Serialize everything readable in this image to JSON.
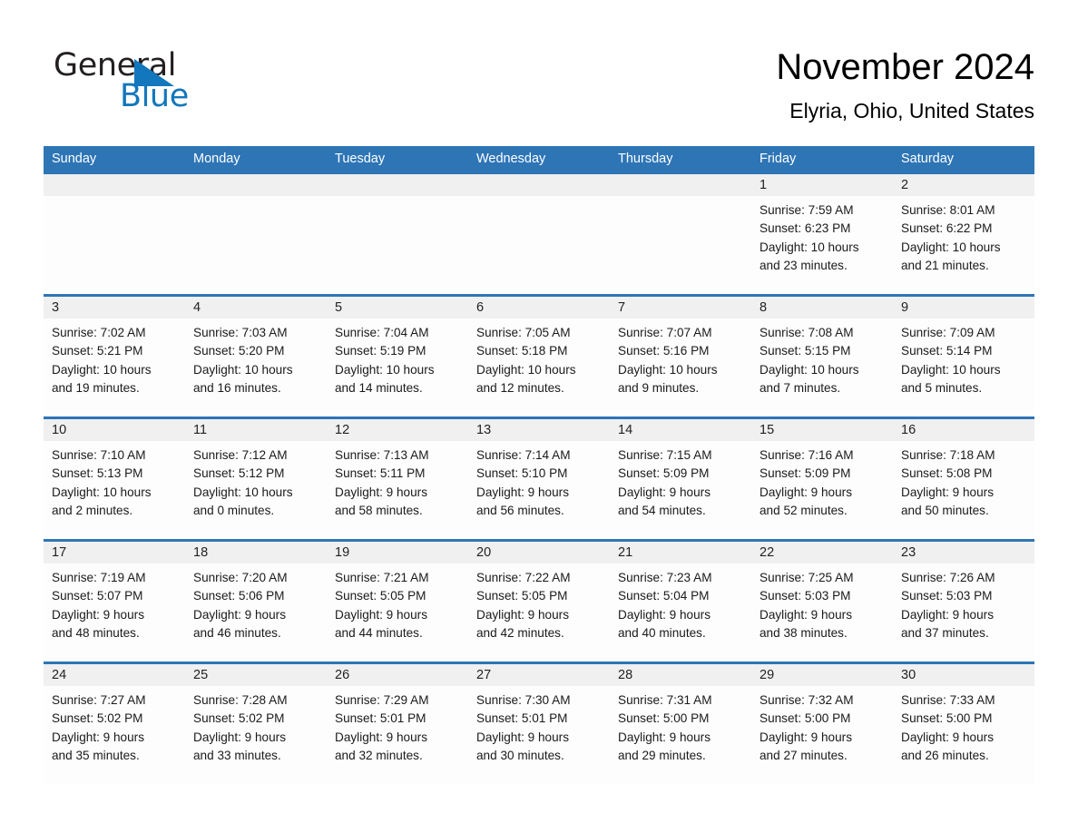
{
  "logo": {
    "word_one": "General",
    "word_two": "Blue",
    "triangle_color": "#1277bc"
  },
  "header": {
    "month_title": "November 2024",
    "location": "Elyria, Ohio, United States"
  },
  "colors": {
    "header_blue": "#2e75b6",
    "day_strip_gray": "#f0f0f0",
    "logo_blue": "#1277bc"
  },
  "weekdays": [
    "Sunday",
    "Monday",
    "Tuesday",
    "Wednesday",
    "Thursday",
    "Friday",
    "Saturday"
  ],
  "weeks": [
    [
      {
        "date": "",
        "sunrise": "",
        "sunset": "",
        "daylight_line1": "",
        "daylight_line2": ""
      },
      {
        "date": "",
        "sunrise": "",
        "sunset": "",
        "daylight_line1": "",
        "daylight_line2": ""
      },
      {
        "date": "",
        "sunrise": "",
        "sunset": "",
        "daylight_line1": "",
        "daylight_line2": ""
      },
      {
        "date": "",
        "sunrise": "",
        "sunset": "",
        "daylight_line1": "",
        "daylight_line2": ""
      },
      {
        "date": "",
        "sunrise": "",
        "sunset": "",
        "daylight_line1": "",
        "daylight_line2": ""
      },
      {
        "date": "1",
        "sunrise": "Sunrise: 7:59 AM",
        "sunset": "Sunset: 6:23 PM",
        "daylight_line1": "Daylight: 10 hours",
        "daylight_line2": "and 23 minutes."
      },
      {
        "date": "2",
        "sunrise": "Sunrise: 8:01 AM",
        "sunset": "Sunset: 6:22 PM",
        "daylight_line1": "Daylight: 10 hours",
        "daylight_line2": "and 21 minutes."
      }
    ],
    [
      {
        "date": "3",
        "sunrise": "Sunrise: 7:02 AM",
        "sunset": "Sunset: 5:21 PM",
        "daylight_line1": "Daylight: 10 hours",
        "daylight_line2": "and 19 minutes."
      },
      {
        "date": "4",
        "sunrise": "Sunrise: 7:03 AM",
        "sunset": "Sunset: 5:20 PM",
        "daylight_line1": "Daylight: 10 hours",
        "daylight_line2": "and 16 minutes."
      },
      {
        "date": "5",
        "sunrise": "Sunrise: 7:04 AM",
        "sunset": "Sunset: 5:19 PM",
        "daylight_line1": "Daylight: 10 hours",
        "daylight_line2": "and 14 minutes."
      },
      {
        "date": "6",
        "sunrise": "Sunrise: 7:05 AM",
        "sunset": "Sunset: 5:18 PM",
        "daylight_line1": "Daylight: 10 hours",
        "daylight_line2": "and 12 minutes."
      },
      {
        "date": "7",
        "sunrise": "Sunrise: 7:07 AM",
        "sunset": "Sunset: 5:16 PM",
        "daylight_line1": "Daylight: 10 hours",
        "daylight_line2": "and 9 minutes."
      },
      {
        "date": "8",
        "sunrise": "Sunrise: 7:08 AM",
        "sunset": "Sunset: 5:15 PM",
        "daylight_line1": "Daylight: 10 hours",
        "daylight_line2": "and 7 minutes."
      },
      {
        "date": "9",
        "sunrise": "Sunrise: 7:09 AM",
        "sunset": "Sunset: 5:14 PM",
        "daylight_line1": "Daylight: 10 hours",
        "daylight_line2": "and 5 minutes."
      }
    ],
    [
      {
        "date": "10",
        "sunrise": "Sunrise: 7:10 AM",
        "sunset": "Sunset: 5:13 PM",
        "daylight_line1": "Daylight: 10 hours",
        "daylight_line2": "and 2 minutes."
      },
      {
        "date": "11",
        "sunrise": "Sunrise: 7:12 AM",
        "sunset": "Sunset: 5:12 PM",
        "daylight_line1": "Daylight: 10 hours",
        "daylight_line2": "and 0 minutes."
      },
      {
        "date": "12",
        "sunrise": "Sunrise: 7:13 AM",
        "sunset": "Sunset: 5:11 PM",
        "daylight_line1": "Daylight: 9 hours",
        "daylight_line2": "and 58 minutes."
      },
      {
        "date": "13",
        "sunrise": "Sunrise: 7:14 AM",
        "sunset": "Sunset: 5:10 PM",
        "daylight_line1": "Daylight: 9 hours",
        "daylight_line2": "and 56 minutes."
      },
      {
        "date": "14",
        "sunrise": "Sunrise: 7:15 AM",
        "sunset": "Sunset: 5:09 PM",
        "daylight_line1": "Daylight: 9 hours",
        "daylight_line2": "and 54 minutes."
      },
      {
        "date": "15",
        "sunrise": "Sunrise: 7:16 AM",
        "sunset": "Sunset: 5:09 PM",
        "daylight_line1": "Daylight: 9 hours",
        "daylight_line2": "and 52 minutes."
      },
      {
        "date": "16",
        "sunrise": "Sunrise: 7:18 AM",
        "sunset": "Sunset: 5:08 PM",
        "daylight_line1": "Daylight: 9 hours",
        "daylight_line2": "and 50 minutes."
      }
    ],
    [
      {
        "date": "17",
        "sunrise": "Sunrise: 7:19 AM",
        "sunset": "Sunset: 5:07 PM",
        "daylight_line1": "Daylight: 9 hours",
        "daylight_line2": "and 48 minutes."
      },
      {
        "date": "18",
        "sunrise": "Sunrise: 7:20 AM",
        "sunset": "Sunset: 5:06 PM",
        "daylight_line1": "Daylight: 9 hours",
        "daylight_line2": "and 46 minutes."
      },
      {
        "date": "19",
        "sunrise": "Sunrise: 7:21 AM",
        "sunset": "Sunset: 5:05 PM",
        "daylight_line1": "Daylight: 9 hours",
        "daylight_line2": "and 44 minutes."
      },
      {
        "date": "20",
        "sunrise": "Sunrise: 7:22 AM",
        "sunset": "Sunset: 5:05 PM",
        "daylight_line1": "Daylight: 9 hours",
        "daylight_line2": "and 42 minutes."
      },
      {
        "date": "21",
        "sunrise": "Sunrise: 7:23 AM",
        "sunset": "Sunset: 5:04 PM",
        "daylight_line1": "Daylight: 9 hours",
        "daylight_line2": "and 40 minutes."
      },
      {
        "date": "22",
        "sunrise": "Sunrise: 7:25 AM",
        "sunset": "Sunset: 5:03 PM",
        "daylight_line1": "Daylight: 9 hours",
        "daylight_line2": "and 38 minutes."
      },
      {
        "date": "23",
        "sunrise": "Sunrise: 7:26 AM",
        "sunset": "Sunset: 5:03 PM",
        "daylight_line1": "Daylight: 9 hours",
        "daylight_line2": "and 37 minutes."
      }
    ],
    [
      {
        "date": "24",
        "sunrise": "Sunrise: 7:27 AM",
        "sunset": "Sunset: 5:02 PM",
        "daylight_line1": "Daylight: 9 hours",
        "daylight_line2": "and 35 minutes."
      },
      {
        "date": "25",
        "sunrise": "Sunrise: 7:28 AM",
        "sunset": "Sunset: 5:02 PM",
        "daylight_line1": "Daylight: 9 hours",
        "daylight_line2": "and 33 minutes."
      },
      {
        "date": "26",
        "sunrise": "Sunrise: 7:29 AM",
        "sunset": "Sunset: 5:01 PM",
        "daylight_line1": "Daylight: 9 hours",
        "daylight_line2": "and 32 minutes."
      },
      {
        "date": "27",
        "sunrise": "Sunrise: 7:30 AM",
        "sunset": "Sunset: 5:01 PM",
        "daylight_line1": "Daylight: 9 hours",
        "daylight_line2": "and 30 minutes."
      },
      {
        "date": "28",
        "sunrise": "Sunrise: 7:31 AM",
        "sunset": "Sunset: 5:00 PM",
        "daylight_line1": "Daylight: 9 hours",
        "daylight_line2": "and 29 minutes."
      },
      {
        "date": "29",
        "sunrise": "Sunrise: 7:32 AM",
        "sunset": "Sunset: 5:00 PM",
        "daylight_line1": "Daylight: 9 hours",
        "daylight_line2": "and 27 minutes."
      },
      {
        "date": "30",
        "sunrise": "Sunrise: 7:33 AM",
        "sunset": "Sunset: 5:00 PM",
        "daylight_line1": "Daylight: 9 hours",
        "daylight_line2": "and 26 minutes."
      }
    ]
  ]
}
